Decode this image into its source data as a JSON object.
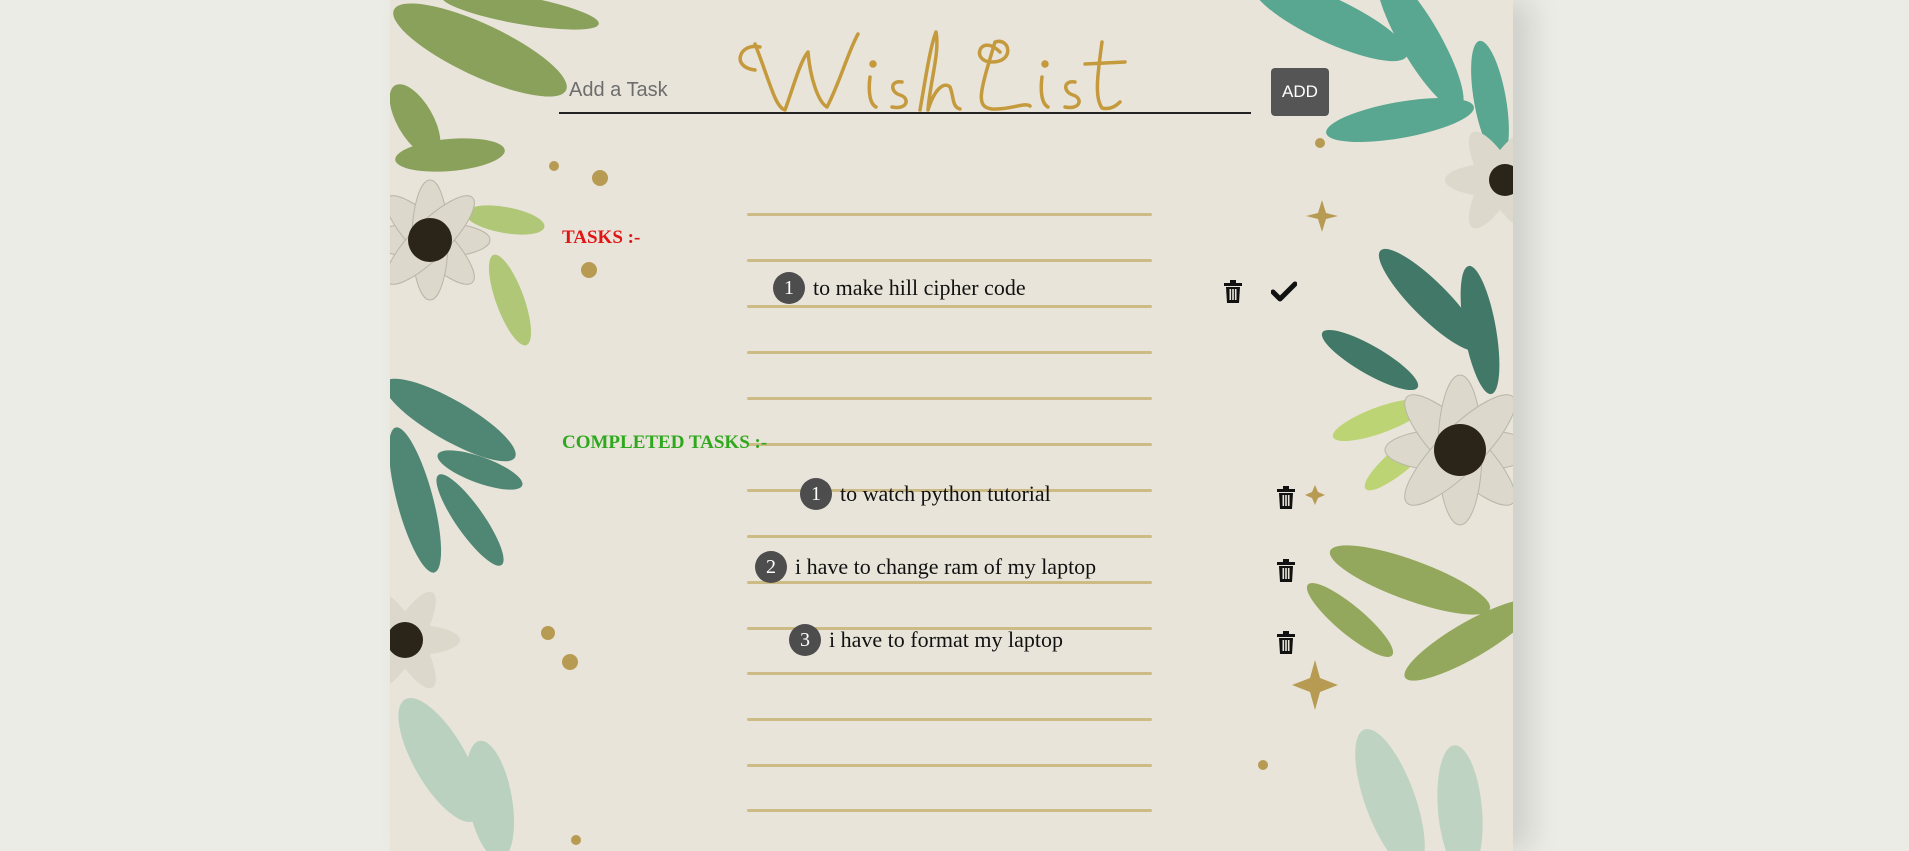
{
  "title": "Wish List",
  "input": {
    "placeholder": "Add a Task",
    "value": ""
  },
  "add_button": {
    "label": "ADD"
  },
  "tasks_heading": "TASKS :-",
  "completed_heading": "COMPLETED TASKS :-",
  "tasks": [
    {
      "number": "1",
      "text": "to make hill cipher code"
    }
  ],
  "completed": [
    {
      "number": "1",
      "text": "to watch python tutorial"
    },
    {
      "number": "2",
      "text": "i have to change ram of my laptop"
    },
    {
      "number": "3",
      "text": "i have to format my laptop"
    }
  ],
  "colors": {
    "tasks_heading": "#e01515",
    "completed_heading": "#2fa81e",
    "button": "#555555",
    "badge": "#4d4d4d",
    "title_gold": "#c49a3c"
  },
  "icons": [
    "trash-icon",
    "checkmark-icon"
  ]
}
